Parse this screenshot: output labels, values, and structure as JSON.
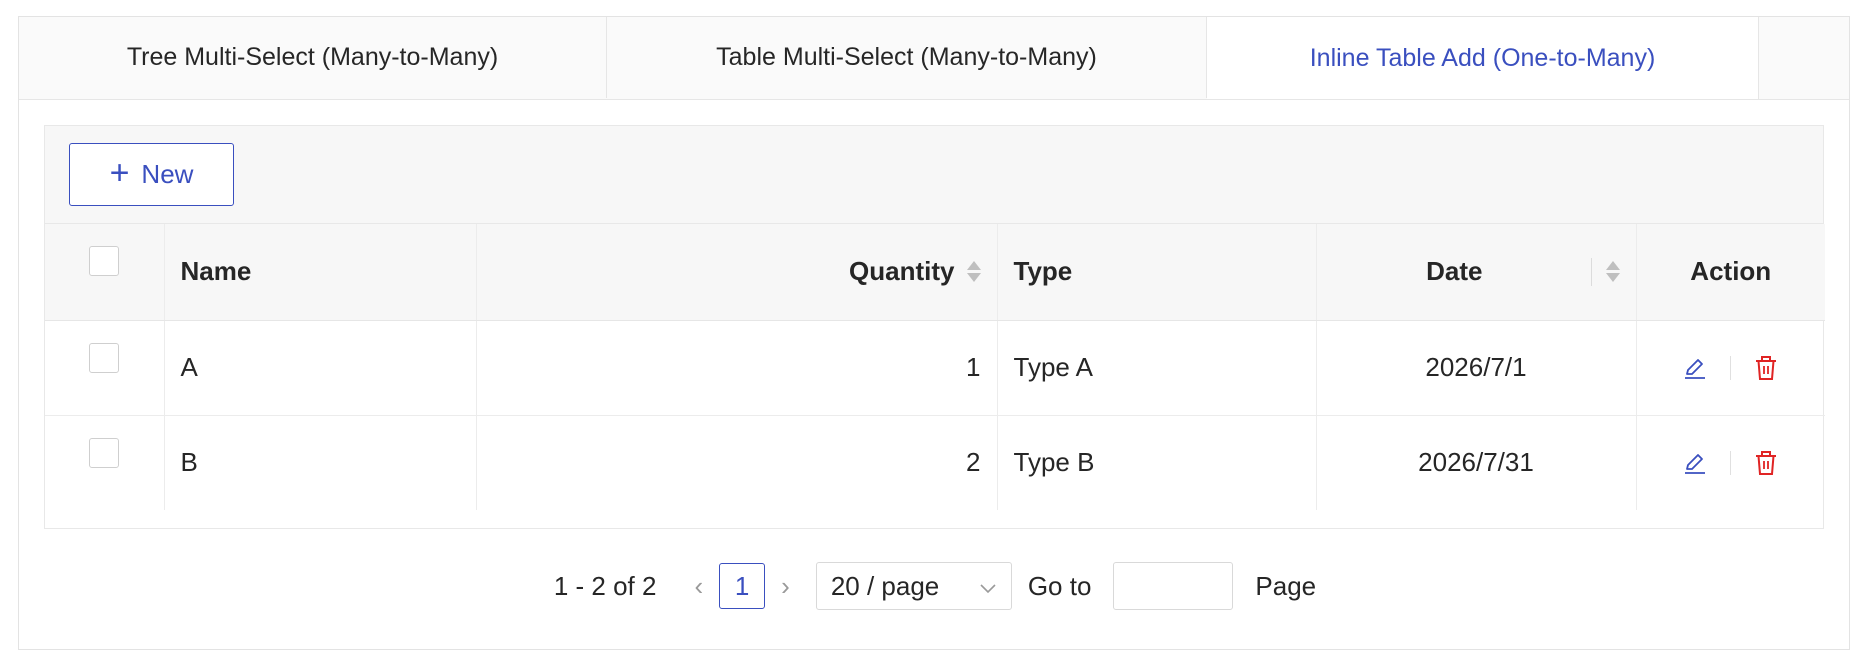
{
  "tabs": [
    {
      "label": "Tree Multi-Select (Many-to-Many)"
    },
    {
      "label": "Table Multi-Select (Many-to-Many)"
    },
    {
      "label": "Inline Table Add (One-to-Many)"
    }
  ],
  "active_tab": 2,
  "toolbar": {
    "new_label": "New"
  },
  "table": {
    "columns": {
      "name": "Name",
      "quantity": "Quantity",
      "type": "Type",
      "date": "Date",
      "action": "Action"
    },
    "rows": [
      {
        "name": "A",
        "quantity": "1",
        "type": "Type A",
        "date": "2026/7/1"
      },
      {
        "name": "B",
        "quantity": "2",
        "type": "Type B",
        "date": "2026/7/31"
      }
    ]
  },
  "pagination": {
    "total_text": "1 - 2 of 2",
    "current_page": "1",
    "page_size": "20 / page",
    "goto_label": "Go to",
    "goto_value": "",
    "page_label": "Page"
  },
  "colors": {
    "accent": "#3a4fbf",
    "danger": "#e02424",
    "border": "#e8e8e8"
  },
  "icons": {
    "add": "plus-icon",
    "edit": "edit-pencil-icon",
    "delete": "trash-icon",
    "sort": "sort-icon",
    "prev": "chevron-left-icon",
    "next": "chevron-right-icon",
    "dropdown": "chevron-down-icon"
  }
}
